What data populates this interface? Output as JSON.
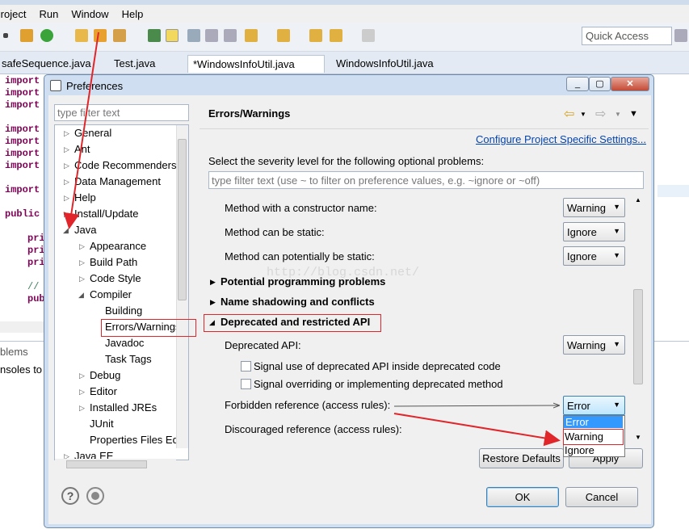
{
  "menu": [
    "Project",
    "Run",
    "Window",
    "Help"
  ],
  "quick_access": "Quick Access",
  "editor_tabs": [
    "safeSequence.java",
    "Test.java",
    "*WindowsInfoUtil.java",
    "WindowsInfoUtil.java"
  ],
  "code_lines": [
    "import",
    "import",
    "import",
    "import",
    "import",
    "import",
    "import",
    "import",
    "public",
    "pri",
    "pri",
    "pri",
    "//",
    "pub"
  ],
  "bottom_tabs": [
    "blems",
    "nsoles to"
  ],
  "dialog": {
    "title": "Preferences",
    "filter_placeholder": "type filter text",
    "tree": [
      "General",
      "Ant",
      "Code Recommenders",
      "Data Management",
      "Help",
      "Install/Update",
      "Java",
      "Appearance",
      "Build Path",
      "Code Style",
      "Compiler",
      "Building",
      "Errors/Warnings",
      "Javadoc",
      "Task Tags",
      "Debug",
      "Editor",
      "Installed JREs",
      "JUnit",
      "Properties Files Ed",
      "Java EE"
    ],
    "page_title": "Errors/Warnings",
    "config_link": "Configure Project Specific Settings...",
    "severity_label": "Select the severity level for the following optional problems:",
    "right_filter_placeholder": "type filter text (use ~ to filter on preference values, e.g. ~ignore or ~off)",
    "options": [
      {
        "label": "Method with a constructor name:",
        "value": "Warning"
      },
      {
        "label": "Method can be static:",
        "value": "Ignore"
      },
      {
        "label": "Method can potentially be static:",
        "value": "Ignore"
      }
    ],
    "sections": [
      "Potential programming problems",
      "Name shadowing and conflicts",
      "Deprecated and restricted API"
    ],
    "deprecated_api_label": "Deprecated API:",
    "deprecated_api_value": "Warning",
    "check1": "Signal use of deprecated API inside deprecated code",
    "check2": "Signal overriding or implementing deprecated method",
    "forbidden_label": "Forbidden reference (access rules):",
    "forbidden_value": "Error",
    "discouraged_label": "Discouraged reference (access rules):",
    "dropdown_options": [
      "Error",
      "Warning",
      "Ignore"
    ],
    "restore_defaults": "Restore Defaults",
    "apply": "Apply",
    "ok": "OK",
    "cancel": "Cancel",
    "watermark": "http://blog.csdn.net/"
  }
}
